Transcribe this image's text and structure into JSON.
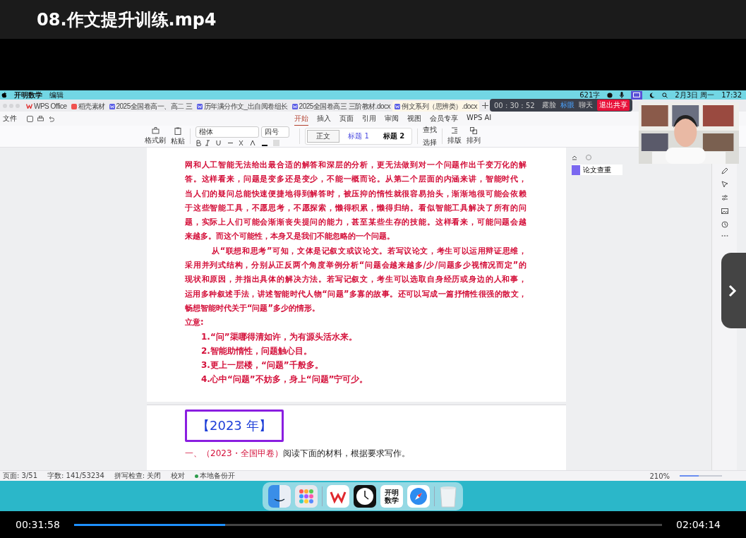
{
  "player": {
    "title": "08.作文提升训练.mp4",
    "elapsed": "00:31:58",
    "total": "02:04:14",
    "level": 0.257
  },
  "menubar": {
    "app": "开明数学",
    "menu": [
      "编辑"
    ],
    "word_count": "621字",
    "date": "2月3日 周一",
    "time": "17:32"
  },
  "share_toolbar": {
    "timer": "00 : 30 : 52",
    "items": [
      "露脸",
      "标眼",
      "聊天"
    ],
    "exit": "退出共享"
  },
  "doc_tabs": [
    {
      "label": "WPS Office",
      "kind": "home",
      "selected": false
    },
    {
      "label": "稻壳素材",
      "kind": "store",
      "selected": false
    },
    {
      "label": "2025全国卷高一、高二 三",
      "kind": "doc",
      "selected": false
    },
    {
      "label": "历年满分作文_出自阅卷组长",
      "kind": "doc",
      "selected": false
    },
    {
      "label": "2025全国卷高三 三阶教材.docx",
      "kind": "doc",
      "selected": false
    },
    {
      "label": "例文系列（思辨类）.docx",
      "kind": "doc",
      "selected": true
    }
  ],
  "file_menu": "文件",
  "ribbon_tabs": [
    {
      "label": "开始",
      "selected": true
    },
    {
      "label": "插入",
      "selected": false
    },
    {
      "label": "页面",
      "selected": false
    },
    {
      "label": "引用",
      "selected": false
    },
    {
      "label": "审阅",
      "selected": false
    },
    {
      "label": "视图",
      "selected": false
    },
    {
      "label": "会员专享",
      "selected": false
    },
    {
      "label": "WPS AI",
      "selected": false
    }
  ],
  "ribbon": {
    "format_painter": "格式刷",
    "paste": "粘贴",
    "font": "楷体",
    "size": "四号",
    "styles": [
      {
        "label": "正文",
        "selected": true
      },
      {
        "label": "标题 1",
        "selected": false
      },
      {
        "label": "标题 2",
        "selected": false
      }
    ],
    "find": "查找",
    "select": "选择",
    "layout": "排版",
    "arrange": "排列"
  },
  "page1": {
    "paragraphs": [
      {
        "indent": false,
        "lines": [
          "网和人工智能无法给出最合适的解答和深层的分析，更无法做到对一个问题作出千变万化的解",
          "答。这样看来，问题是变多还是变少，不能一概而论。从第二个层面的内涵来讲，智能时代，",
          "当人们的疑问总能快速便捷地得到解答时，被压抑的惰性就很容易抬头，渐渐地很可能会依赖",
          "于这些智能工具，不愿思考，不愿探索，懒得积累，懒得归纳。看似智能工具解决了所有的问",
          "题，实际上人们可能会渐渐丧失提问的能力，甚至某些生存的技能。这样看来，可能问题会越",
          "来越多。而这个可能性，本身又是我们不能忽略的一个问题。"
        ]
      },
      {
        "indent": true,
        "lines": [
          "从“联想和思考”可知，文体是记叙文或议论文。若写议论文，考生可以运用辩证思维，",
          "采用并列式结构，分别从正反两个角度举例分析“问题会越来越多/少/问题多少视情况而定”的",
          "现状和原因，并指出具体的解决方法。若写记叙文，考生可以选取自身经历或身边的人和事，",
          "运用多种叙述手法，讲述智能时代人物“问题”多寡的故事。还可以写成一篇抒情性很强的散文，",
          "畅想智能时代关于“问题”多少的情形。"
        ]
      }
    ],
    "heading": "立意:",
    "points": [
      "1.“问”渠哪得清如许，为有源头活水来。",
      "2.智能助惰性，问题触心目。",
      "3.更上一层楼，“问题”千般多。",
      "4.心中“问题”不妨多，身上“问题”宁可少。"
    ]
  },
  "page2": {
    "year_title": "【2023 年】",
    "question_prefix": "一、（2023・全国甲卷）",
    "question": "阅读下面的材料，根据要求写作。"
  },
  "side_panel": {
    "button": "论文查重"
  },
  "status_bar": {
    "items": [
      "页面: 3/51",
      "字数: 141/53234",
      "拼写检查: 关闭",
      "校对",
      "本地备份开"
    ],
    "zoom": "210%",
    "zoom_slider": {
      "level": 0.45
    }
  },
  "dock": [
    {
      "kind": "finder"
    },
    {
      "kind": "launchpad"
    },
    {
      "kind": "wps"
    },
    {
      "kind": "clock"
    },
    {
      "kind": "app",
      "lines": [
        "开明",
        "数学"
      ]
    },
    {
      "kind": "safari"
    },
    {
      "kind": "trash"
    }
  ]
}
